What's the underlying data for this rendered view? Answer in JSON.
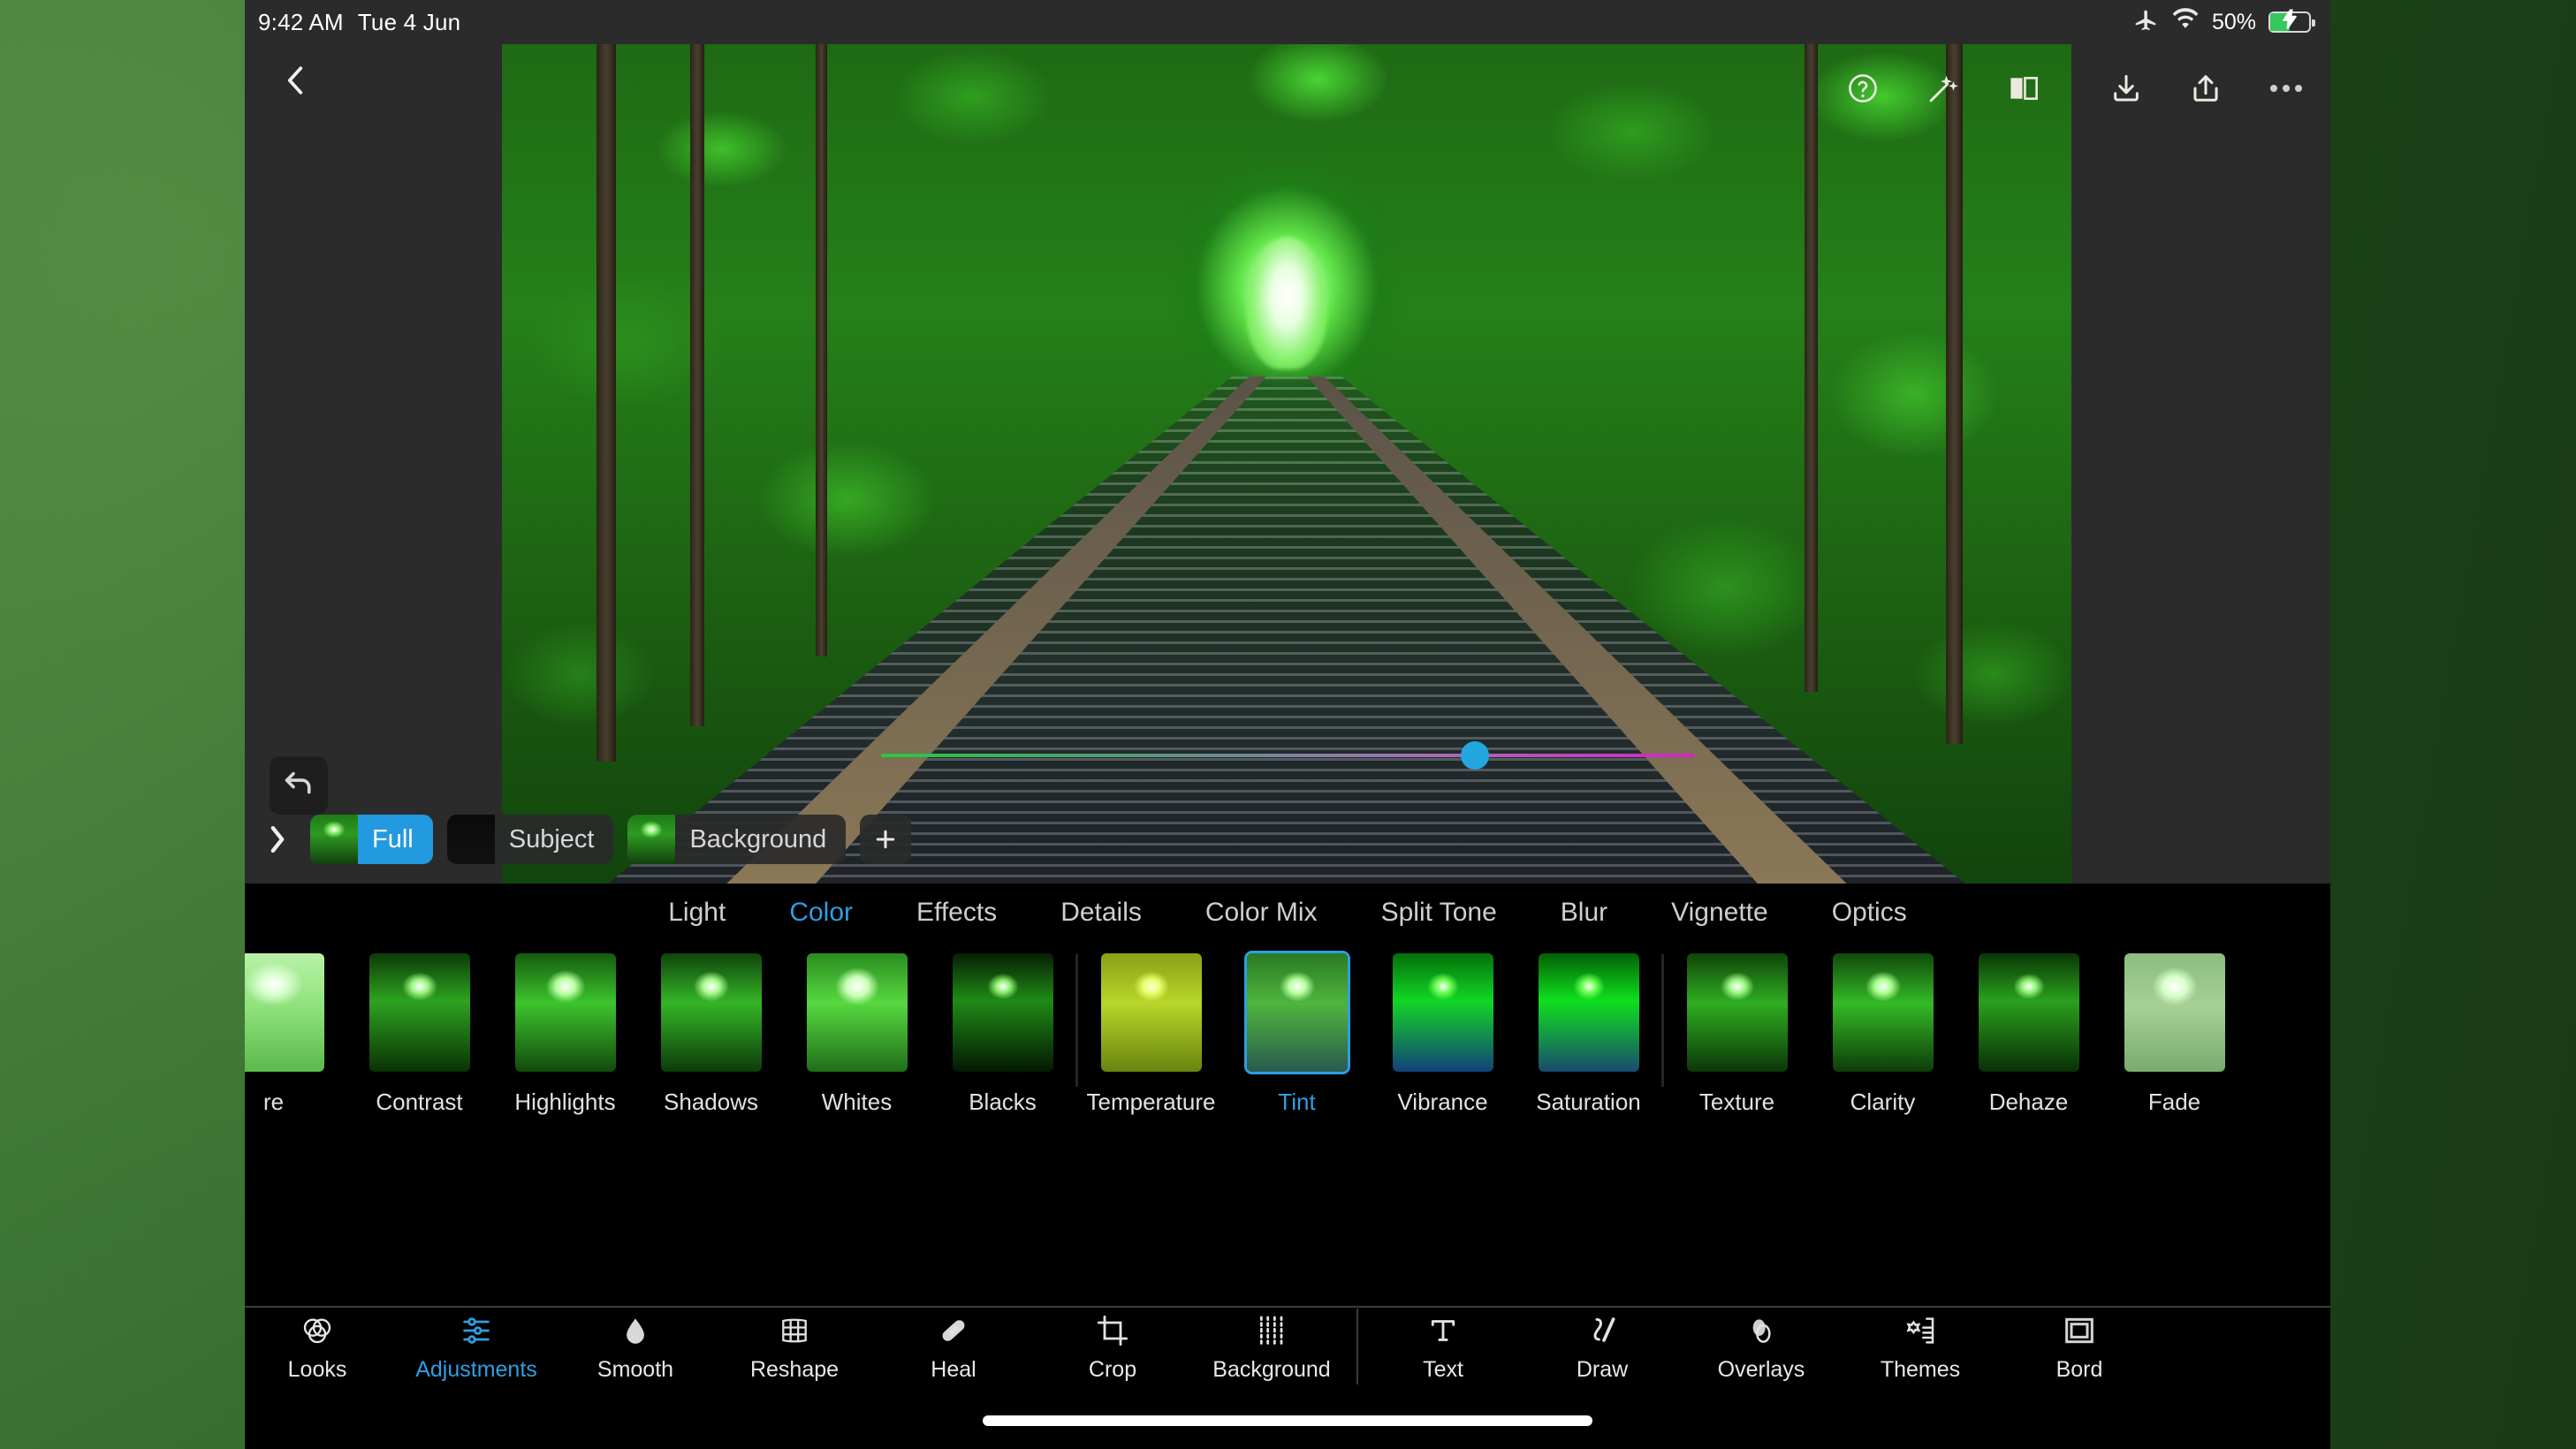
{
  "statusbar": {
    "time": "9:42 AM",
    "date": "Tue 4 Jun",
    "battery_percent": "50%",
    "airplane_icon": "airplane-icon",
    "wifi_icon": "wifi-icon",
    "battery_icon": "battery-charging-icon"
  },
  "topbar": {
    "back_icon": "back-chevron-icon",
    "help_icon": "help-question-icon",
    "magic_icon": "magic-wand-icon",
    "compare_icon": "before-after-compare-icon",
    "download_icon": "download-icon",
    "share_icon": "share-icon",
    "more_icon": "more-options-icon"
  },
  "canvas": {
    "undo_icon": "undo-arrow-icon"
  },
  "masks": {
    "expand_icon": "expand-chevron-right-icon",
    "add_label": "+",
    "items": [
      {
        "label": "Full",
        "selected": true,
        "thumb": "full-image-thumb"
      },
      {
        "label": "Subject",
        "selected": false,
        "thumb": "subject-mask-thumb"
      },
      {
        "label": "Background",
        "selected": false,
        "thumb": "background-mask-thumb"
      }
    ]
  },
  "slider": {
    "name": "tint-slider",
    "value_percent": 73,
    "gradient_from": "#27c93f",
    "gradient_to": "#d126c0",
    "thumb_color": "#22a7e0"
  },
  "tabs": {
    "active": "Color",
    "items": [
      {
        "label": "Light"
      },
      {
        "label": "Color"
      },
      {
        "label": "Effects"
      },
      {
        "label": "Details"
      },
      {
        "label": "Color Mix"
      },
      {
        "label": "Split Tone"
      },
      {
        "label": "Blur"
      },
      {
        "label": "Vignette"
      },
      {
        "label": "Optics"
      }
    ]
  },
  "adjustments": {
    "selected": "Tint",
    "items": [
      {
        "label": "re",
        "group": 0,
        "tone": "exposure"
      },
      {
        "label": "Contrast",
        "group": 0,
        "tone": "contrast"
      },
      {
        "label": "Highlights",
        "group": 0,
        "tone": "highlights"
      },
      {
        "label": "Shadows",
        "group": 0,
        "tone": "shadows"
      },
      {
        "label": "Whites",
        "group": 0,
        "tone": "whites"
      },
      {
        "label": "Blacks",
        "group": 0,
        "tone": "blacks"
      },
      {
        "label": "Temperature",
        "group": 1,
        "tone": "temperature"
      },
      {
        "label": "Tint",
        "group": 1,
        "tone": "tint"
      },
      {
        "label": "Vibrance",
        "group": 1,
        "tone": "vibrance"
      },
      {
        "label": "Saturation",
        "group": 1,
        "tone": "saturation"
      },
      {
        "label": "Texture",
        "group": 2,
        "tone": "texture"
      },
      {
        "label": "Clarity",
        "group": 2,
        "tone": "clarity"
      },
      {
        "label": "Dehaze",
        "group": 2,
        "tone": "dehaze"
      },
      {
        "label": "Fade",
        "group": 2,
        "tone": "fade"
      }
    ]
  },
  "toolbar": {
    "active": "Adjustments",
    "items": [
      {
        "label": "Looks",
        "icon": "looks-venn-icon"
      },
      {
        "label": "Adjustments",
        "icon": "sliders-icon"
      },
      {
        "label": "Smooth",
        "icon": "droplet-icon"
      },
      {
        "label": "Reshape",
        "icon": "mesh-grid-icon"
      },
      {
        "label": "Heal",
        "icon": "bandage-icon"
      },
      {
        "label": "Crop",
        "icon": "crop-icon"
      },
      {
        "label": "Background",
        "icon": "background-dots-icon"
      },
      {
        "label": "Text",
        "icon": "text-t-icon"
      },
      {
        "label": "Draw",
        "icon": "draw-pen-icon"
      },
      {
        "label": "Overlays",
        "icon": "overlays-circles-icon"
      },
      {
        "label": "Themes",
        "icon": "themes-icon"
      },
      {
        "label": "Bord",
        "icon": "borders-icon"
      }
    ]
  },
  "home": {
    "indicator": "home-indicator-bar"
  }
}
